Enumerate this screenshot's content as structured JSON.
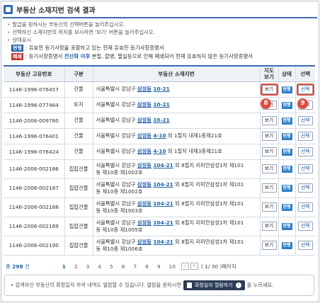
{
  "page": {
    "title": "부동산 소재지번 검색 결과",
    "notes": [
      "말급을 원하시는 부동산의 선택버튼을 눌러주십시오.",
      "선택하신 소재지번의 위치를 보시려면 '보기' 버튼을 눌러주십시오.",
      "상태표시"
    ],
    "legend": {
      "valid_tag": "현행",
      "valid_text": "유효한 등기사항을 포함하고 있는 현재 유효한 등기사항증명서",
      "closed_tag": "폐쇄",
      "closed_prefix": "등기사항증명서 ",
      "closed_highlight": "전산화 이후",
      "closed_suffix": " 분필, 합병, 멸실등으로 인해 폐쇄되어 현재 유효하지 않은 등기사항증명서"
    }
  },
  "table": {
    "headers": [
      "부동산 고유번호",
      "구분",
      "부동산 소재지번",
      "지도\n보기",
      "상태",
      "선택"
    ],
    "rows": [
      {
        "id": "1146-1996-076457",
        "type": "건물",
        "a1": "서울특별시 강남구 ",
        "a2": "삼성동",
        "a3": "10-21",
        "a4": "",
        "a5": "",
        "view": "보기",
        "state": "현행",
        "select": "선택"
      },
      {
        "id": "1146-1996-077464",
        "type": "토지",
        "a1": "서울특별시 강남구 ",
        "a2": "삼성동",
        "a3": "10-21",
        "a4": "",
        "a5": "",
        "view": "보기",
        "state": "현행",
        "select": "선택"
      },
      {
        "id": "1146-2006-009780",
        "type": "건물",
        "a1": "서울특별시 강남구 ",
        "a2": "삼성동",
        "a3": "10-21",
        "a4": "",
        "a5": "",
        "view": "보기",
        "state": "현행",
        "select": "선택"
      },
      {
        "id": "1146-1996-076401",
        "type": "건물",
        "a1": "서울특별시 강남구 ",
        "a2": "삼성동",
        "a3": "4-10",
        "a4": " 외 1필지 내제1층제",
        "a5": "21호",
        "view": "보기",
        "state": "현행",
        "select": "선택"
      },
      {
        "id": "1146-1996-076424",
        "type": "건물",
        "a1": "서울특별시 강남구 ",
        "a2": "삼성동",
        "a3": "4-10",
        "a4": " 외 1필지 내제3층제",
        "a5": "21호",
        "view": "보기",
        "state": "현행",
        "select": "선택"
      },
      {
        "id": "1146-2006-002186",
        "type": "집합건물",
        "a1": "서울특별시 강남구 ",
        "a2": "삼성동",
        "a3": "104-21",
        "a4": " 외 8필지 리미안삼성1차 제101",
        "a5": "동 제10층 제1002호",
        "view": "보기",
        "state": "현행",
        "select": "선택"
      },
      {
        "id": "1146-2006-002187",
        "type": "집합건물",
        "a1": "서울특별시 강남구 ",
        "a2": "삼성동",
        "a3": "104-21",
        "a4": " 외 8필지 리미안삼성1차 제101",
        "a5": "동 제10층 제1002호",
        "view": "보기",
        "state": "현행",
        "select": "선택"
      },
      {
        "id": "1146-2006-002188",
        "type": "집합건물",
        "a1": "서울특별시 강남구 ",
        "a2": "삼성동",
        "a3": "104-21",
        "a4": " 외 8필지 리미안삼성1차 제101",
        "a5": "동 제10층 제1003호",
        "view": "보기",
        "state": "현행",
        "select": "선택"
      },
      {
        "id": "1146-2006-002189",
        "type": "집합건물",
        "a1": "서울특별시 강남구 ",
        "a2": "삼성동",
        "a3": "104-21",
        "a4": " 외 8필지 리미안삼성1차 제101",
        "a5": "동 제10층 제1005호",
        "view": "보기",
        "state": "현행",
        "select": "선택"
      },
      {
        "id": "1146-2006-002190",
        "type": "집합건물",
        "a1": "서울특별시 강남구 ",
        "a2": "삼성동",
        "a3": "104-21",
        "a4": " 외 8필지 리미안삼성1차 제101",
        "a5": "동 제10층 제1006호",
        "view": "보기",
        "state": "현행",
        "select": "선택"
      }
    ]
  },
  "markers": {
    "view": "8",
    "select": "9"
  },
  "pager": {
    "total_prefix": "총 ",
    "total_count": "298",
    "total_suffix": " 건",
    "pages": [
      "1",
      "2",
      "3",
      "4",
      "5",
      "6",
      "7",
      "8",
      "9",
      "10"
    ],
    "next": "›",
    "last": "»",
    "info": "( 1/ 30 )페이지"
  },
  "footer": {
    "text_before": "• 검색하신 부동산의 확정일자 부여 내역도 열람할 수 있습니다. 열람을 원하시면",
    "button_label": "확정일자 열람하기",
    "button_go": "›",
    "text_after": "를 누르세요."
  },
  "colors": {
    "accent": "#3a6cb0",
    "link": "#1f5fae",
    "state": "#2b7fc9",
    "marker": "#e24b3b"
  }
}
